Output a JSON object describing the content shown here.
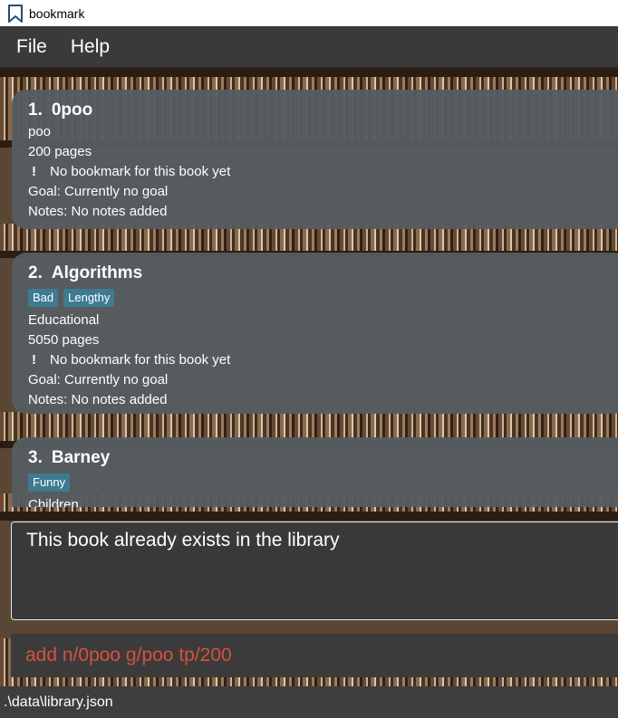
{
  "window": {
    "title": "bookmark"
  },
  "menu": {
    "file": "File",
    "help": "Help"
  },
  "books": [
    {
      "index": "1.",
      "name": "0poo",
      "tags": [],
      "genre": "poo",
      "pages": "200 pages",
      "bookmark_icon": "!",
      "bookmark": "No bookmark for this book yet",
      "goal": "Goal: Currently no goal",
      "notes": "Notes: No notes added"
    },
    {
      "index": "2.",
      "name": "Algorithms",
      "tags": [
        "Bad",
        "Lengthy"
      ],
      "genre": "Educational",
      "pages": "5050 pages",
      "bookmark_icon": "!",
      "bookmark": "No bookmark for this book yet",
      "goal": "Goal: Currently no goal",
      "notes": "Notes: No notes added"
    },
    {
      "index": "3.",
      "name": "Barney",
      "tags": [
        "Funny"
      ],
      "genre": "Children"
    }
  ],
  "result": {
    "message": "This book already exists in the library"
  },
  "command": {
    "text": "add n/0poo g/poo tp/200"
  },
  "status": {
    "path": ".\\data\\library.json"
  },
  "colors": {
    "tag": "#3e7b91",
    "card": "#565c60",
    "command_error_text": "#d9503f"
  }
}
